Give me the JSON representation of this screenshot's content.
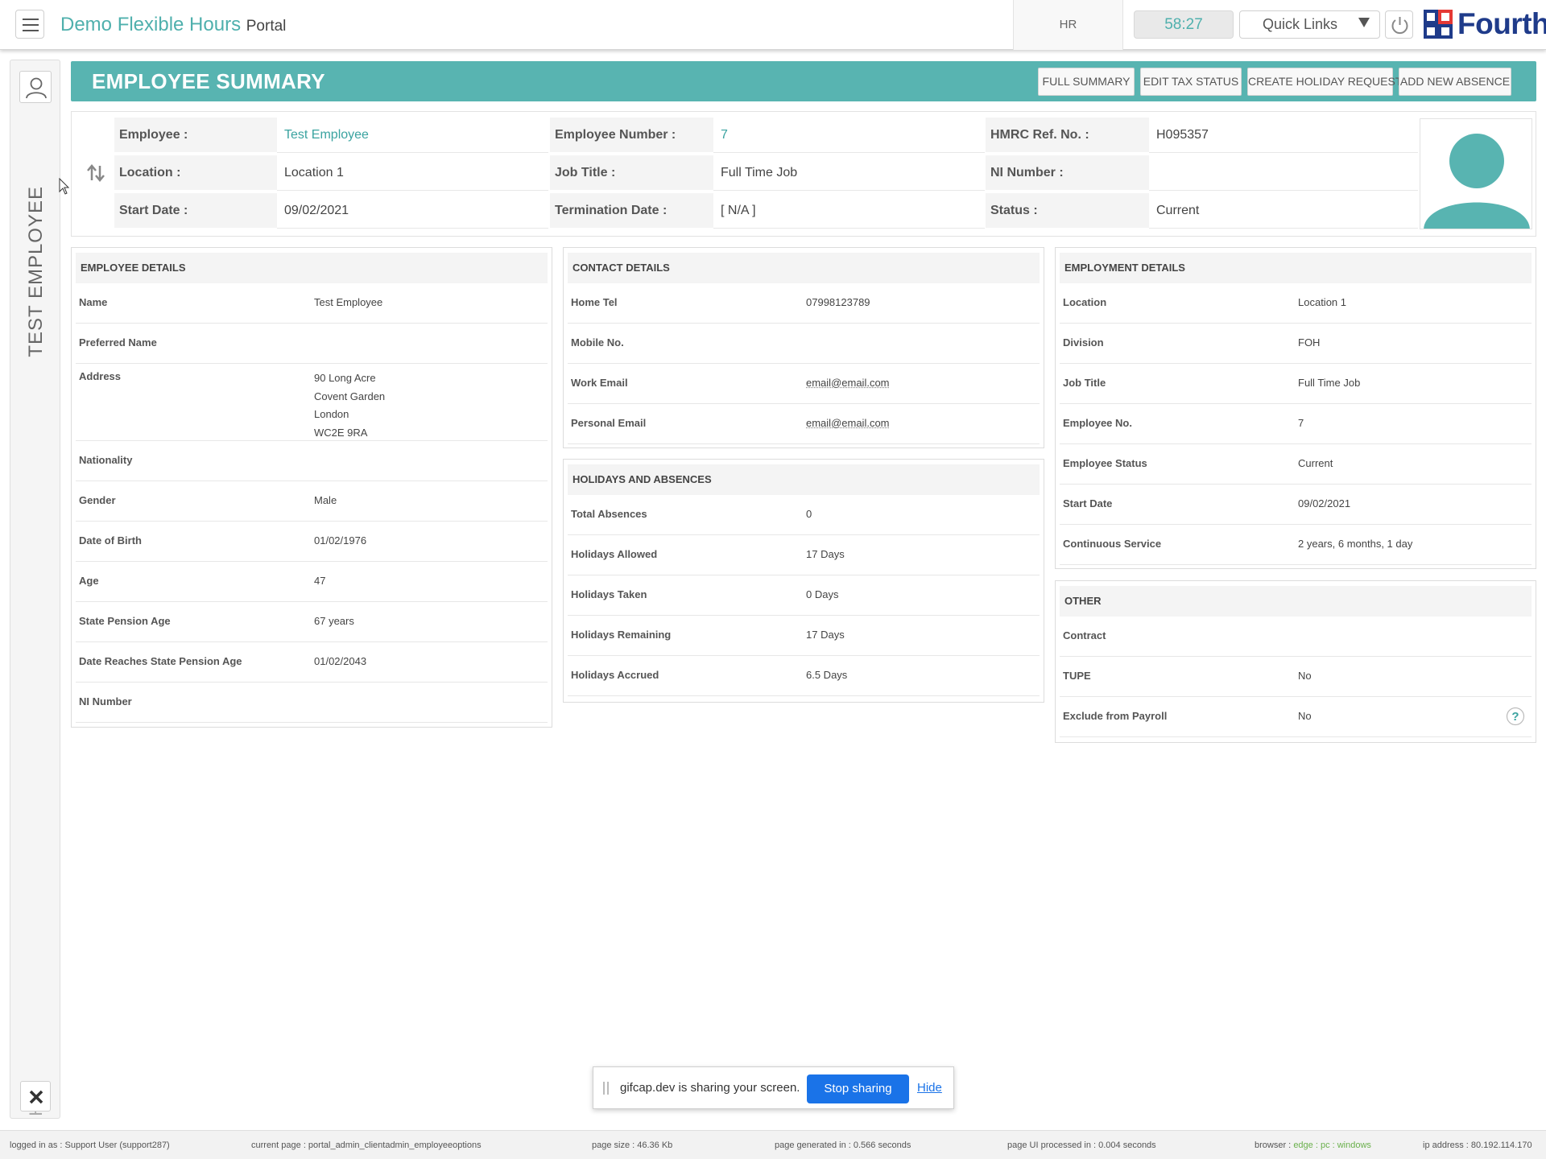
{
  "topbar": {
    "brand": "Demo Flexible Hours",
    "brand_suffix": "Portal",
    "module": "HR",
    "timer": "58:27",
    "quick_links": "Quick Links",
    "logo_text": "Fourth",
    "accent_color": "#58b4b1",
    "logo_color": "#1f3b8a"
  },
  "sidebar": {
    "employee_name": "TEST EMPLOYEE",
    "module": "HR"
  },
  "banner": {
    "title": "EMPLOYEE SUMMARY",
    "buttons": [
      "FULL SUMMARY",
      "EDIT TAX STATUS",
      "CREATE HOLIDAY REQUEST",
      "ADD NEW ABSENCE"
    ]
  },
  "summary": {
    "employee_label": "Employee :",
    "employee_value": "Test Employee",
    "employee_number_label": "Employee Number :",
    "employee_number_value": "7",
    "hmrc_label": "HMRC Ref. No. :",
    "hmrc_value": "H095357",
    "location_label": "Location :",
    "location_value": "Location 1",
    "job_title_label": "Job Title :",
    "job_title_value": "Full Time Job",
    "ni_label": "NI Number :",
    "ni_value": "",
    "start_label": "Start Date :",
    "start_value": "09/02/2021",
    "termination_label": "Termination Date :",
    "termination_value": "[ N/A ]",
    "status_label": "Status :",
    "status_value": "Current"
  },
  "employee_details": {
    "title": "EMPLOYEE DETAILS",
    "rows": [
      {
        "label": "Name",
        "value": "Test Employee"
      },
      {
        "label": "Preferred Name",
        "value": ""
      },
      {
        "label": "Address",
        "lines": [
          "90 Long Acre",
          "Covent Garden",
          "London",
          "WC2E 9RA"
        ]
      },
      {
        "label": "Nationality",
        "value": ""
      },
      {
        "label": "Gender",
        "value": "Male"
      },
      {
        "label": "Date of Birth",
        "value": "01/02/1976"
      },
      {
        "label": "Age",
        "value": "47"
      },
      {
        "label": "State Pension Age",
        "value": "67 years"
      },
      {
        "label": "Date Reaches State Pension Age",
        "value": "01/02/2043"
      },
      {
        "label": "NI Number",
        "value": ""
      }
    ]
  },
  "contact_details": {
    "title": "CONTACT DETAILS",
    "rows": [
      {
        "label": "Home Tel",
        "value": "07998123789"
      },
      {
        "label": "Mobile No.",
        "value": ""
      },
      {
        "label": "Work Email",
        "value": "email@email.com"
      },
      {
        "label": "Personal Email",
        "value": "email@email.com"
      }
    ]
  },
  "holidays": {
    "title": "HOLIDAYS AND ABSENCES",
    "rows": [
      {
        "label": "Total Absences",
        "value": "0"
      },
      {
        "label": "Holidays Allowed",
        "value": "17 Days"
      },
      {
        "label": "Holidays Taken",
        "value": "0 Days"
      },
      {
        "label": "Holidays Remaining",
        "value": "17 Days"
      },
      {
        "label": "Holidays Accrued",
        "value": "6.5 Days"
      }
    ]
  },
  "employment_details": {
    "title": "EMPLOYMENT DETAILS",
    "rows": [
      {
        "label": "Location",
        "value": "Location 1"
      },
      {
        "label": "Division",
        "value": "FOH"
      },
      {
        "label": "Job Title",
        "value": "Full Time Job"
      },
      {
        "label": "Employee No.",
        "value": "7"
      },
      {
        "label": "Employee Status",
        "value": "Current"
      },
      {
        "label": "Start Date",
        "value": "09/02/2021"
      },
      {
        "label": "Continuous Service",
        "value": "2 years, 6 months, 1 day"
      }
    ]
  },
  "other": {
    "title": "OTHER",
    "rows": [
      {
        "label": "Contract",
        "value": ""
      },
      {
        "label": "TUPE",
        "value": "No"
      },
      {
        "label": "Exclude from Payroll",
        "value": "No"
      }
    ]
  },
  "sharebar": {
    "text": "gifcap.dev is sharing your screen.",
    "stop_label": "Stop sharing",
    "hide_label": "Hide"
  },
  "footer": {
    "logged_in": "logged in as : Support User (support287)",
    "current_page": "current page : portal_admin_clientadmin_employeeoptions",
    "page_size": "page size : 46.36 Kb",
    "generated": "page generated in : 0.566 seconds",
    "ui_processed": "page UI processed in : 0.004 seconds",
    "browser_label": "browser :",
    "browser_value": "edge : pc : windows",
    "ip": "ip address : 80.192.114.170"
  }
}
